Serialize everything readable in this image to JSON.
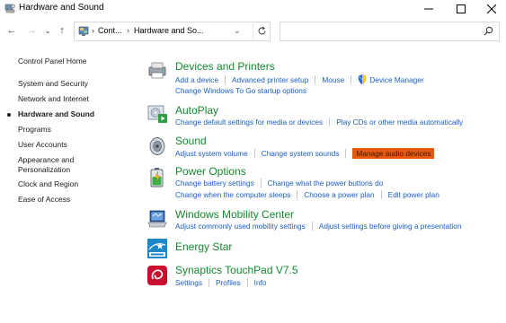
{
  "window": {
    "title": "Hardware and Sound",
    "minimize_glyph": "—",
    "maximize_glyph": "☐",
    "close_glyph": "✕"
  },
  "nav": {
    "back_glyph": "←",
    "forward_glyph": "→",
    "recent_glyph": "⌄",
    "up_glyph": "↑"
  },
  "address": {
    "crumbs": [
      "Cont...",
      "Hardware and So..."
    ],
    "separator": "›",
    "dropdown_glyph": "⌄"
  },
  "search": {
    "placeholder": ""
  },
  "sidebar": {
    "items": [
      "Control Panel Home",
      "System and Security",
      "Network and Internet",
      "Hardware and Sound",
      "Programs",
      "User Accounts",
      "Appearance and Personalization",
      "Clock and Region",
      "Ease of Access"
    ],
    "appearance_line1": "Appearance and",
    "appearance_line2": "Personalization",
    "current_index": 3
  },
  "categories": {
    "devices": {
      "title": "Devices and Printers",
      "row1": [
        "Add a device",
        "Advanced printer setup",
        "Mouse",
        "Device Manager"
      ],
      "row2": [
        "Change Windows To Go startup options"
      ]
    },
    "autoplay": {
      "title": "AutoPlay",
      "row1": [
        "Change default settings for media or devices",
        "Play CDs or other media automatically"
      ]
    },
    "sound": {
      "title": "Sound",
      "row1": [
        "Adjust system volume",
        "Change system sounds",
        "Manage audio devices"
      ],
      "highlight_color": "#e8590c"
    },
    "power": {
      "title": "Power Options",
      "row1": [
        "Change battery settings",
        "Change what the power buttons do"
      ],
      "row2": [
        "Change when the computer sleeps",
        "Choose a power plan",
        "Edit power plan"
      ]
    },
    "mobility": {
      "title": "Windows Mobility Center",
      "row1": [
        "Adjust commonly used mobility settings",
        "Adjust settings before giving a presentation"
      ]
    },
    "energy": {
      "title": "Energy Star"
    },
    "touchpad": {
      "title": "Synaptics TouchPad V7.5",
      "row1": [
        "Settings",
        "Profiles",
        "Info"
      ]
    }
  },
  "colors": {
    "category_title": "#138a2e",
    "link": "#1a5ec5"
  }
}
